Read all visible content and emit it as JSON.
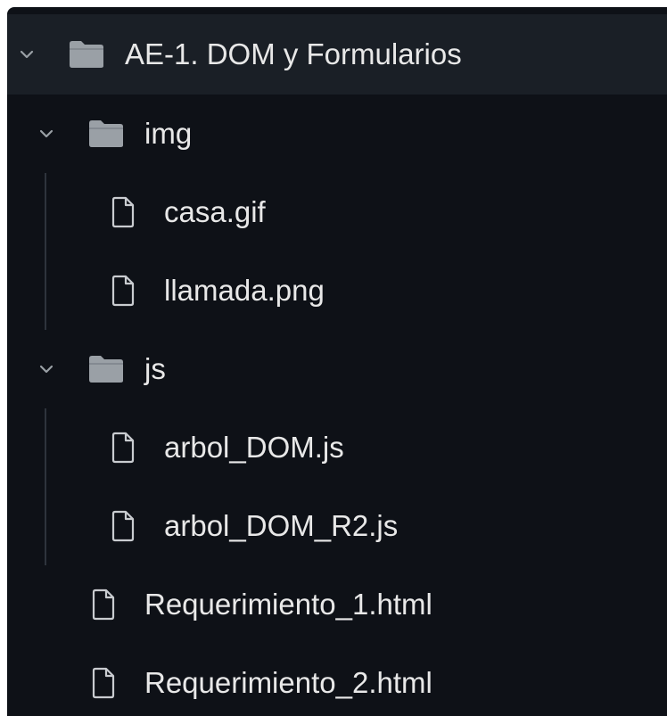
{
  "explorer": {
    "root": {
      "label": "AE-1. DOM y Formularios",
      "expanded": true,
      "icon": "folder-icon"
    },
    "folders": [
      {
        "label": "img",
        "expanded": true,
        "icon": "folder-icon",
        "files": [
          {
            "label": "casa.gif",
            "icon": "file-icon"
          },
          {
            "label": "llamada.png",
            "icon": "file-icon"
          }
        ]
      },
      {
        "label": "js",
        "expanded": true,
        "icon": "folder-icon",
        "files": [
          {
            "label": "arbol_DOM.js",
            "icon": "file-icon"
          },
          {
            "label": "arbol_DOM_R2.js",
            "icon": "file-icon"
          }
        ]
      }
    ],
    "files": [
      {
        "label": "Requerimiento_1.html",
        "icon": "file-icon"
      },
      {
        "label": "Requerimiento_2.html",
        "icon": "file-icon"
      }
    ]
  },
  "colors": {
    "background": "#0e1117",
    "root_row_background": "#1a1f26",
    "text": "#e8e8e8",
    "icon": "#9aa0a6",
    "guide": "#2e343c"
  }
}
